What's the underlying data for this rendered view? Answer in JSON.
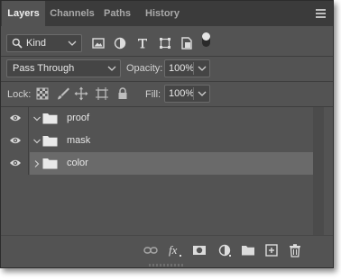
{
  "tabs": [
    {
      "label": "Layers",
      "active": true
    },
    {
      "label": "Channels",
      "active": false
    },
    {
      "label": "Paths",
      "active": false
    },
    {
      "label": "History",
      "active": false
    }
  ],
  "filter": {
    "kind_label": "Kind",
    "icons": [
      "pixel-layer-filter-icon",
      "adjustment-layer-filter-icon",
      "type-layer-filter-icon",
      "shape-layer-filter-icon",
      "smart-object-filter-icon"
    ],
    "toggle_on": true
  },
  "blend": {
    "mode": "Pass Through",
    "opacity_label": "Opacity:",
    "opacity_value": "100%"
  },
  "lock": {
    "label": "Lock:",
    "icons": [
      "lock-transparent-pixels-icon",
      "lock-image-pixels-icon",
      "lock-position-icon",
      "lock-artboard-icon",
      "lock-all-icon"
    ],
    "fill_label": "Fill:",
    "fill_value": "100%"
  },
  "layers": [
    {
      "name": "proof",
      "visible": true,
      "expanded": true,
      "selected": false
    },
    {
      "name": "mask",
      "visible": true,
      "expanded": true,
      "selected": false
    },
    {
      "name": "color",
      "visible": true,
      "expanded": false,
      "selected": true
    }
  ],
  "footer_icons": [
    "link-layers-icon",
    "fx-icon",
    "add-mask-icon",
    "adjustment-layer-icon",
    "new-group-icon",
    "new-layer-icon",
    "delete-icon"
  ],
  "colors": {
    "panel_bg": "#535353",
    "tabbar_bg": "#3b3b3b",
    "selected_row": "#6a6a6a",
    "text": "#e6e6e6"
  }
}
